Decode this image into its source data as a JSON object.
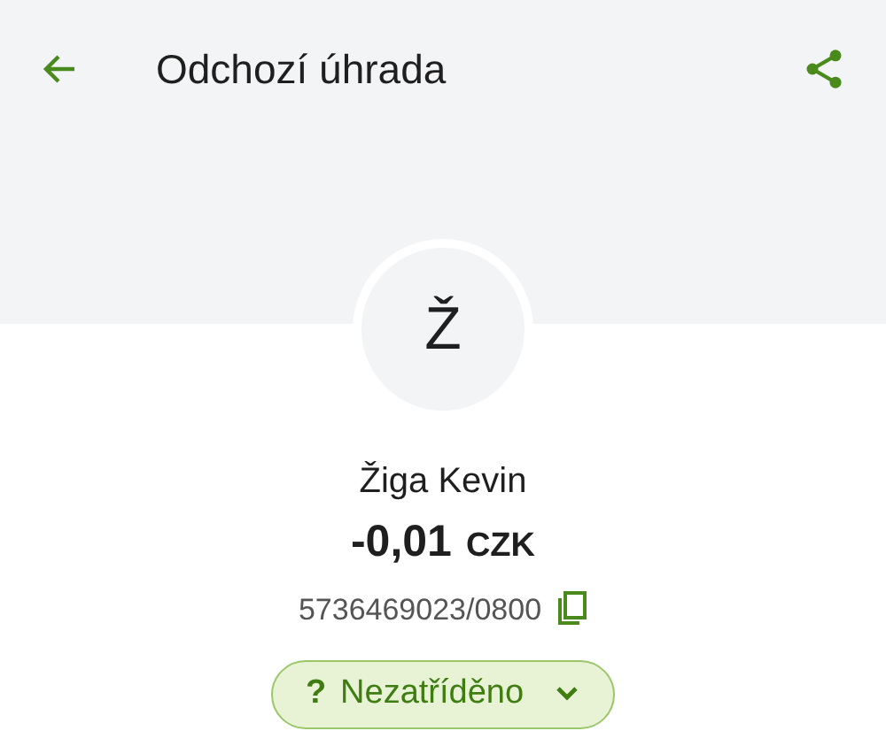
{
  "header": {
    "title": "Odchozí úhrada"
  },
  "counterparty": {
    "initial": "Ž",
    "name": "Žiga Kevin",
    "amount": "-0,01",
    "currency": "CZK",
    "account": "5736469023/0800"
  },
  "category": {
    "symbol": "?",
    "label": "Nezatříděno",
    "expanded": false
  }
}
